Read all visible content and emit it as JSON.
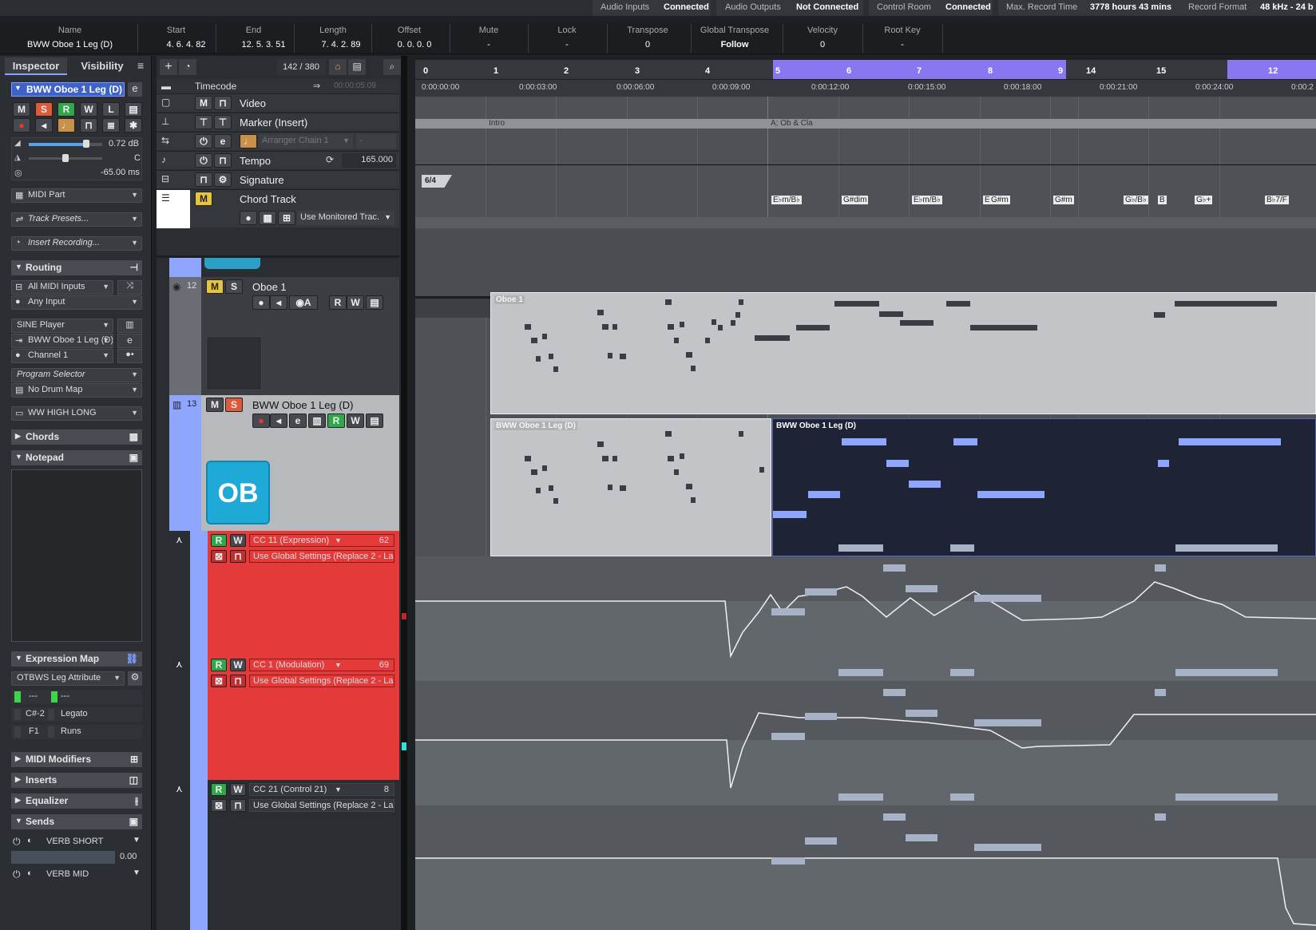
{
  "status": {
    "audio_inputs_label": "Audio Inputs",
    "audio_inputs_value": "Connected",
    "audio_outputs_label": "Audio Outputs",
    "audio_outputs_value": "Not Connected",
    "control_room_label": "Control Room",
    "control_room_value": "Connected",
    "max_rec_label": "Max. Record Time",
    "max_rec_value": "3778 hours 43 mins",
    "rec_format_label": "Record Format",
    "rec_format_value": "48 kHz - 24 b"
  },
  "info": {
    "name_h": "Name",
    "name_v": "BWW Oboe 1 Leg (D)",
    "start_h": "Start",
    "start_v": "4. 6. 4. 82",
    "end_h": "End",
    "end_v": "12. 5. 3. 51",
    "length_h": "Length",
    "length_v": "7. 4. 2. 89",
    "offset_h": "Offset",
    "offset_v": "0. 0. 0.   0",
    "mute_h": "Mute",
    "mute_v": "-",
    "lock_h": "Lock",
    "lock_v": "-",
    "transpose_h": "Transpose",
    "transpose_v": "0",
    "gtranspose_h": "Global Transpose",
    "gtranspose_v": "Follow",
    "velocity_h": "Velocity",
    "velocity_v": "0",
    "rootkey_h": "Root Key",
    "rootkey_v": "-"
  },
  "inspector": {
    "tab_inspector": "Inspector",
    "tab_visibility": "Visibility",
    "track_name": "BWW Oboe 1 Leg (D)",
    "btn_m": "M",
    "btn_s": "S",
    "btn_r": "R",
    "btn_w": "W",
    "btn_l": "L",
    "volume": "0.72 dB",
    "pan": "C",
    "delay": "-65.00 ms",
    "midi_part": "MIDI Part",
    "track_presets": "Track Presets...",
    "insert_recording": "Insert Recording...",
    "routing": "Routing",
    "all_midi_inputs": "All MIDI Inputs",
    "any_input": "Any Input",
    "sine_player": "SINE Player",
    "output_track": "BWW Oboe 1 Leg (D)",
    "channel": "Channel 1",
    "program_selector": "Program Selector",
    "drum_map": "No Drum Map",
    "ww_high_long": "WW HIGH LONG",
    "chords": "Chords",
    "notepad": "Notepad",
    "expression_map": "Expression Map",
    "otbws": "OTBWS Leg Attribute",
    "em_row1_a": "---",
    "em_row1_b": "---",
    "em_row2_key": "C#-2",
    "em_row2_name": "Legato",
    "em_row3_key": "F1",
    "em_row3_name": "Runs",
    "midi_modifiers": "MIDI Modifiers",
    "inserts": "Inserts",
    "equalizer": "Equalizer",
    "sends": "Sends",
    "send1": "VERB SHORT",
    "send1_level": "0.00",
    "send2": "VERB MID"
  },
  "tracks": {
    "counter": "142 / 380",
    "timecode": "Timecode",
    "timecode_val": "00:00:05:09",
    "video": "Video",
    "marker": "Marker (Insert)",
    "arranger": "Arranger Chain 1",
    "tempo": "Tempo",
    "tempo_val": "165.000",
    "signature": "Signature",
    "chord_track": "Chord Track",
    "monitored": "Use Monitored Trac.",
    "oboe1_num": "12",
    "oboe1_name": "Oboe 1",
    "bww_num": "13",
    "bww_name": "BWW Oboe 1 Leg (D)",
    "bww_logo": "OB",
    "cc11": "CC 11  (Expression)",
    "cc11_val": "62",
    "cc11_mode": "Use Global Settings (Replace 2 - Last.",
    "cc1": "CC 1  (Modulation)",
    "cc1_val": "69",
    "cc1_mode": "Use Global Settings (Replace 2 - Last.",
    "cc21": "CC 21  (Control 21)",
    "cc21_val": "8",
    "cc21_mode": "Use Global Settings (Replace 2 - Last."
  },
  "ruler": {
    "bars": [
      "0",
      "1",
      "2",
      "3",
      "4",
      "5",
      "6",
      "7",
      "8",
      "9",
      "14",
      "15",
      "12"
    ],
    "times": [
      "0:00:00:00",
      "0:00:03:00",
      "0:00:06:00",
      "0:00:09:00",
      "0:00:12:00",
      "0:00:15:00",
      "0:00:18:00",
      "0:00:21:00",
      "0:00:24:00",
      "0:00:2"
    ]
  },
  "arrange": {
    "marker_intro": "Intro",
    "marker_a": "A; Ob & Cla",
    "sig": "6/4",
    "chords": [
      "E♭m/B♭",
      "G#dim",
      "E♭m/B♭",
      "E",
      "G#m",
      "G#m",
      "G♭/B♭",
      "B",
      "G♭+",
      "B♭7/F"
    ],
    "part1": "Oboe 1",
    "part2_left": "BWW Oboe 1 Leg (D)",
    "part2_right": "BWW Oboe 1 Leg (D)"
  },
  "colors": {
    "track_blue": "#8aa2ff",
    "cc_red": "#e53a3a",
    "solo": "#e05a3a",
    "rec_green": "#2fa84a"
  }
}
